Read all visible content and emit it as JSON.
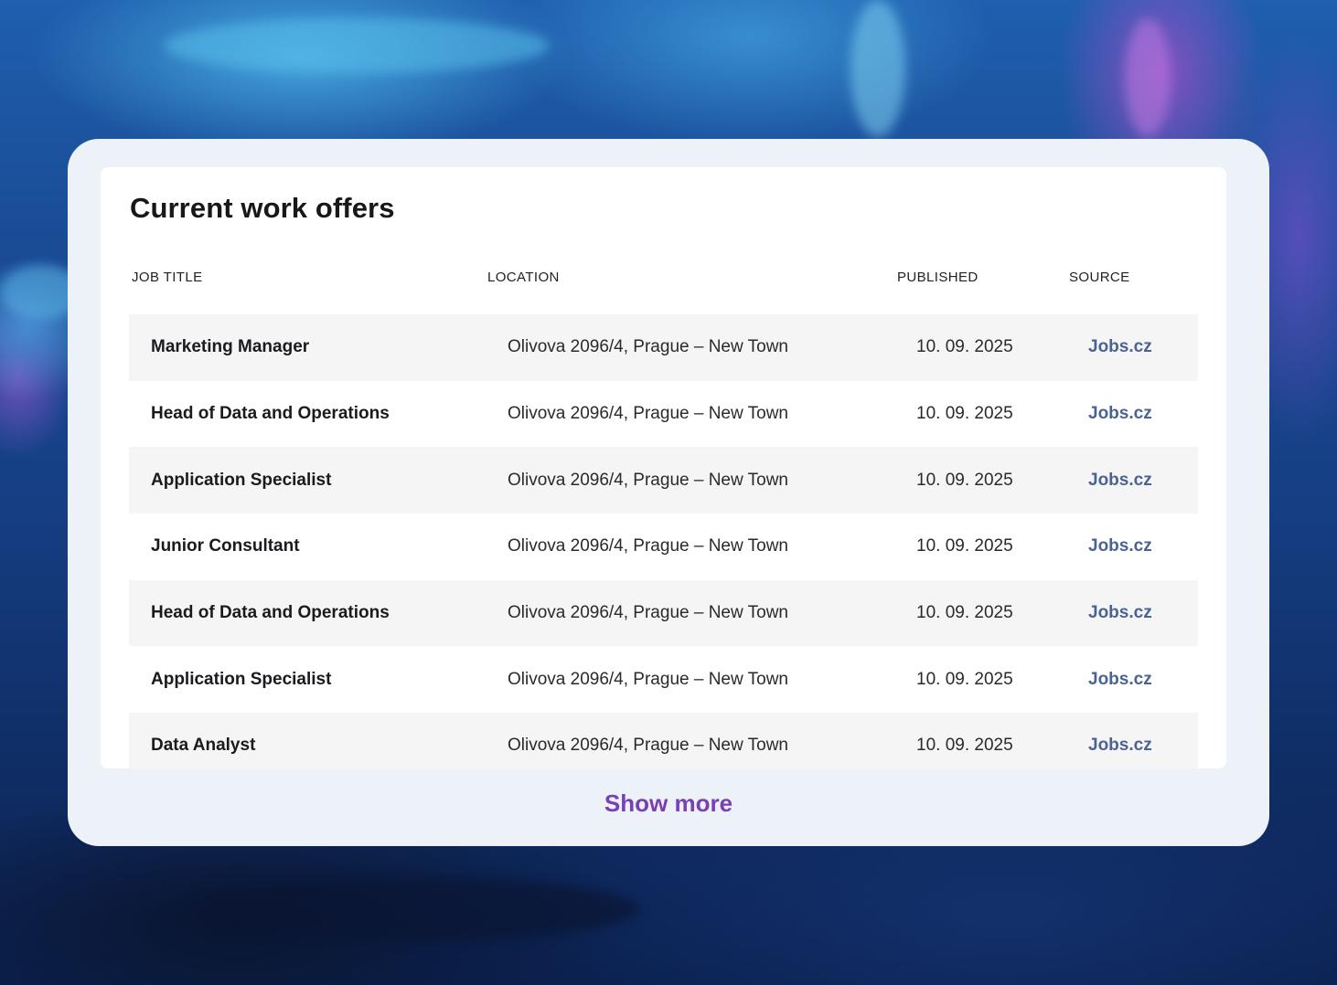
{
  "colors": {
    "card_bg": "#edf1f8",
    "panel_bg": "#ffffff",
    "row_alt_bg": "#f5f5f6",
    "source_link": "#4b6390",
    "show_more": "#7a3fb4"
  },
  "offers": {
    "title": "Current work offers",
    "columns": {
      "job_title": "JOB TITLE",
      "location": "LOCATION",
      "published": "PUBLISHED",
      "source": "SOURCE"
    },
    "rows": [
      {
        "title": "Marketing Manager",
        "location": "Olivova 2096/4, Prague – New Town",
        "published": "10. 09. 2025",
        "source": "Jobs.cz"
      },
      {
        "title": "Head of Data and Operations",
        "location": "Olivova 2096/4, Prague – New Town",
        "published": "10. 09. 2025",
        "source": "Jobs.cz"
      },
      {
        "title": "Application Specialist",
        "location": "Olivova 2096/4, Prague – New Town",
        "published": "10. 09. 2025",
        "source": "Jobs.cz"
      },
      {
        "title": "Junior Consultant",
        "location": "Olivova 2096/4, Prague – New Town",
        "published": "10. 09. 2025",
        "source": "Jobs.cz"
      },
      {
        "title": "Head of Data and Operations",
        "location": "Olivova 2096/4, Prague – New Town",
        "published": "10. 09. 2025",
        "source": "Jobs.cz"
      },
      {
        "title": "Application Specialist",
        "location": "Olivova 2096/4, Prague – New Town",
        "published": "10. 09. 2025",
        "source": "Jobs.cz"
      },
      {
        "title": "Data Analyst",
        "location": "Olivova 2096/4, Prague – New Town",
        "published": "10. 09. 2025",
        "source": "Jobs.cz"
      }
    ],
    "show_more_label": "Show more"
  }
}
